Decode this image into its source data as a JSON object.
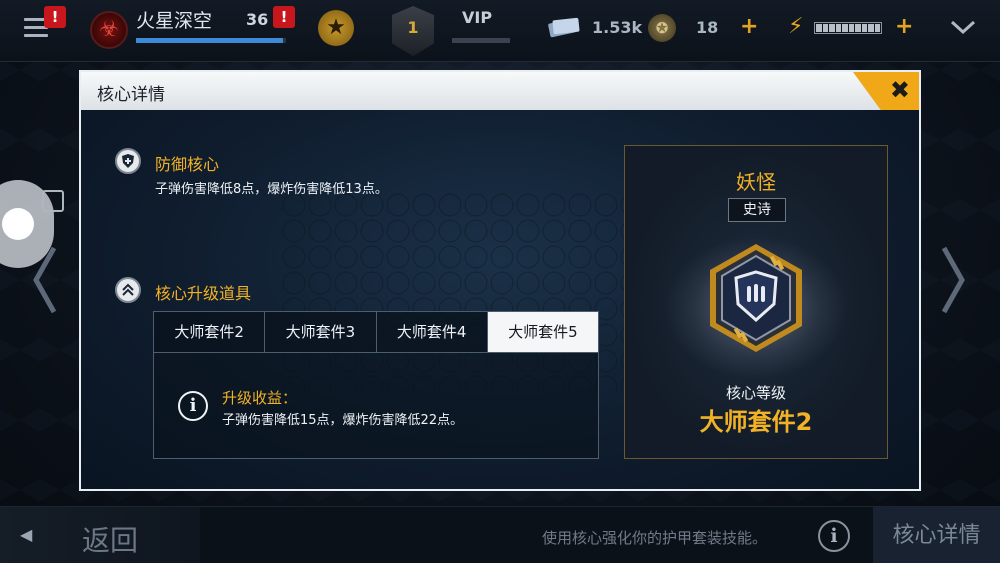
{
  "topbar": {
    "alert_mark": "!",
    "player_name": "火星深空",
    "player_level": "36",
    "xp_progress": 0.98,
    "rank_number": "1",
    "vip_label": "VIP",
    "cash_amount": "1.53k",
    "gold_amount": "18",
    "plus_symbol": "+"
  },
  "modal": {
    "title": "核心详情",
    "defense": {
      "title": "防御核心",
      "description": "子弹伤害降低8点，爆炸伤害降低13点。"
    },
    "upgrade": {
      "title": "核心升级道具",
      "tabs": [
        "大师套件2",
        "大师套件3",
        "大师套件4",
        "大师套件5"
      ],
      "active_tab_index": 3,
      "benefit_title": "升级收益：",
      "benefit_description": "子弹伤害降低15点，爆炸伤害降低22点。"
    },
    "core": {
      "name": "妖怪",
      "rarity": "史诗",
      "level_label": "核心等级",
      "level_value": "大师套件2"
    }
  },
  "bottombar": {
    "back_label": "返回",
    "hint": "使用核心强化你的护甲套装技能。",
    "tab_label": "核心详情"
  },
  "colors": {
    "accent_gold": "#f2b225",
    "close_orange": "#f0a718",
    "alert_red": "#c8161d",
    "xp_blue": "#3d8ad6"
  },
  "icons": [
    "menu-icon",
    "biohazard-icon",
    "star-icon",
    "rank-icon",
    "cash-icon",
    "gold-icon",
    "energy-icon",
    "chevron-down-icon",
    "close-icon",
    "shield-icon",
    "chevron-up-icon",
    "info-icon",
    "armor-core-icon",
    "chevron-left-icon",
    "chevron-right-icon"
  ]
}
